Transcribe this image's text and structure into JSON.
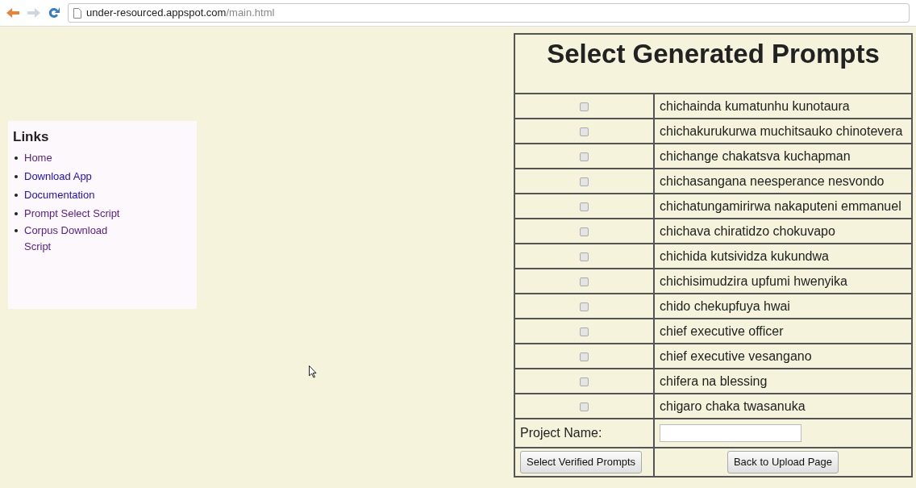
{
  "browser": {
    "url_host": "under-resourced.appspot.com",
    "url_path": "/main.html"
  },
  "sidebar": {
    "title": "Links",
    "links": [
      {
        "label": "Home",
        "visited": true
      },
      {
        "label": "Download App",
        "visited": false
      },
      {
        "label": "Documentation",
        "visited": false
      },
      {
        "label": "Prompt Select Script",
        "visited": true
      },
      {
        "label": "Corpus Download Script",
        "visited": true
      }
    ]
  },
  "table": {
    "title": "Select Generated Prompts",
    "rows": [
      {
        "text": "chichainda kumatunhu kunotaura",
        "checked": false
      },
      {
        "text": "chichakurukurwa muchitsauko chinotevera",
        "checked": false
      },
      {
        "text": "chichange chakatsva kuchapman",
        "checked": false
      },
      {
        "text": "chichasangana neesperance nesvondo",
        "checked": false
      },
      {
        "text": "chichatungamirirwa nakaputeni emmanuel",
        "checked": false
      },
      {
        "text": "chichava chiratidzo chokuvapo",
        "checked": false
      },
      {
        "text": "chichida kutsividza kukundwa",
        "checked": false
      },
      {
        "text": "chichisimudzira upfumi hwenyika",
        "checked": false
      },
      {
        "text": "chido chekupfuya hwai",
        "checked": false
      },
      {
        "text": "chief executive officer",
        "checked": false
      },
      {
        "text": "chief executive vesangano",
        "checked": false
      },
      {
        "text": "chifera na blessing",
        "checked": false
      },
      {
        "text": "chigaro chaka twasanuka",
        "checked": false
      }
    ],
    "project_label": "Project Name:",
    "buttons": [
      "Select Verified Prompts",
      "Back to Upload Page"
    ]
  }
}
